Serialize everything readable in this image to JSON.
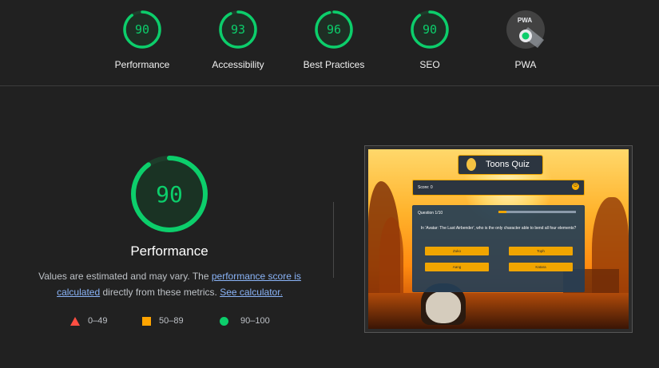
{
  "gauges": [
    {
      "score": "90",
      "label": "Performance",
      "fraction": 0.9
    },
    {
      "score": "93",
      "label": "Accessibility",
      "fraction": 0.93
    },
    {
      "score": "96",
      "label": "Best Practices",
      "fraction": 0.96
    },
    {
      "score": "90",
      "label": "SEO",
      "fraction": 0.9
    },
    {
      "badge": "PWA",
      "label": "PWA"
    }
  ],
  "main": {
    "score": "90",
    "fraction": 0.9,
    "title": "Performance",
    "desc_prefix": "Values are estimated and may vary. The ",
    "desc_link": "performance score is calculated",
    "desc_mid": " directly from these metrics. ",
    "desc_link2": "See calculator."
  },
  "legend": [
    {
      "range": "0–49",
      "color": "#ff4e42"
    },
    {
      "range": "50–89",
      "color": "#ffa400"
    },
    {
      "range": "90–100",
      "color": "#0cce6b"
    }
  ],
  "screenshot": {
    "app_title": "Toons Quiz",
    "score_label": "Score:  0",
    "question_number": "Question 1/10",
    "progress": 0.1,
    "question": "In 'Avatar: The Last Airbender', who is the only character able to bend all four elements?",
    "answers": [
      "Zuko",
      "Toph",
      "Aang",
      "Katara"
    ]
  },
  "colors": {
    "pass": "#0cce6b",
    "pass_bg": "#0a3a21",
    "accent": "#f0a500"
  }
}
